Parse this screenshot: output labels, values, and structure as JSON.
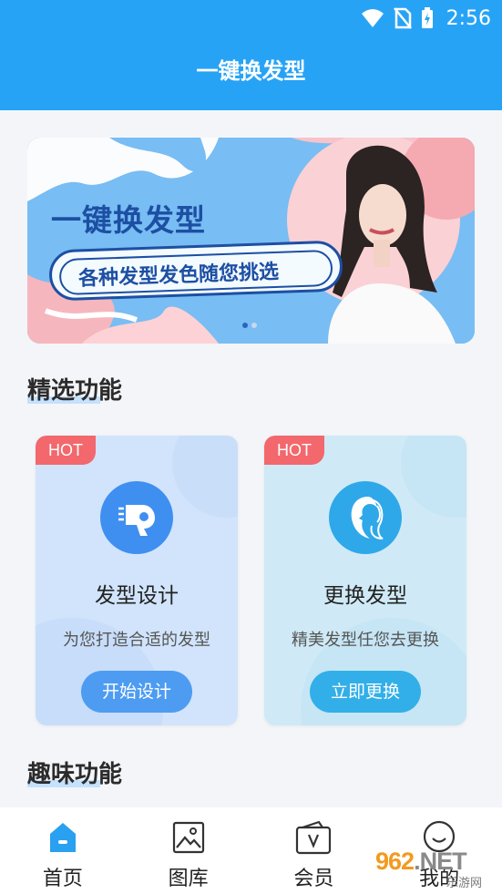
{
  "status_bar": {
    "time": "2:56"
  },
  "header": {
    "title": "一键换发型"
  },
  "banner": {
    "headline": "一键换发型",
    "tagline": "各种发型发色随您挑选",
    "page_count": 2,
    "active_page": 1
  },
  "sections": {
    "featured": "精选功能",
    "fun": "趣味功能"
  },
  "cards": [
    {
      "badge": "HOT",
      "name": "发型设计",
      "desc": "为您打造合适的发型",
      "button": "开始设计",
      "icon": "hair-dryer-icon"
    },
    {
      "badge": "HOT",
      "name": "更换发型",
      "desc": "精美发型任您去更换",
      "button": "立即更换",
      "icon": "woman-profile-icon"
    }
  ],
  "nav": [
    {
      "label": "首页",
      "icon": "home-icon",
      "active": true
    },
    {
      "label": "图库",
      "icon": "gallery-icon",
      "active": false
    },
    {
      "label": "会员",
      "icon": "vip-icon",
      "active": false
    },
    {
      "label": "我的",
      "icon": "smiley-icon",
      "active": false
    }
  ],
  "watermark": {
    "text": "962",
    "suffix": ".NET",
    "sub": "乐游网"
  },
  "colors": {
    "primary": "#27a3f6",
    "hot": "#f2686c",
    "active_nav": "#2aa0f0"
  }
}
